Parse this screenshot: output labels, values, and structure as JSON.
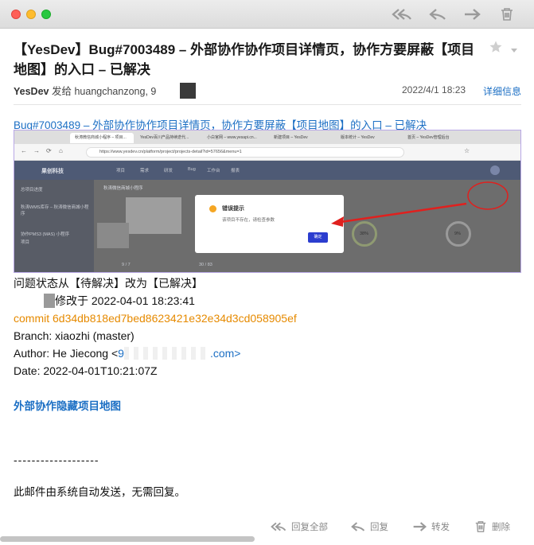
{
  "window": {
    "toolbar": [
      "reply-all-icon",
      "reply-icon",
      "forward-icon",
      "trash-icon"
    ]
  },
  "email": {
    "subject": "【YesDev】Bug#7003489 – 外部协作协作项目详情页，协作方要屏蔽【项目地图】的入口 – 已解决",
    "sender": "YesDev",
    "sent_to_label": "发给",
    "recipient": "huangchanzong, 9",
    "date": "2022/4/1  18:23",
    "details_link": "详细信息",
    "link_text": "Bug#7003489 – 外部协作协作项目详情页，协作方要屏蔽【项目地图】的入口 – 已解决",
    "status_line": "问题状态从【待解决】改为【已解决】",
    "modified_line": "修改于 2022-04-01 18:23:41",
    "commit_line": "commit 6d34db818ed7bed8623421e32e34d3cd058905ef",
    "branch_line": "Branch: xiaozhi (master)",
    "author_prefix": "Author: He Jiecong <",
    "author_email_start": "9",
    "author_email_end": ".com>",
    "date_line": "Date: 2022-04-01T10:21:07Z",
    "hidden_map_link": "外部协作隐藏项目地图",
    "dashes": "-------------------",
    "auto_notice": "此邮件由系统自动发送，无需回复。"
  },
  "screenshot": {
    "tabs": [
      "秋涛微信商城小程序 – 项目...",
      "YesDev百川产品持续迭代...",
      "小白官网 – www.yesapi.cn...",
      "新建项目 – YesDev",
      "版本统计 – YesDev",
      "首页 – YesDev管理后台"
    ],
    "url": "https://www.yesdev.cn/platform/project/projects-detail?id=57656&menu=1",
    "brand": "果创科技",
    "nav": [
      "项目",
      "需求",
      "研发",
      "Bug",
      "工作台",
      "报表"
    ],
    "sidebar": [
      "总项目进度",
      "秋涛WMS库存 – 秋涛微信商城小程序",
      "协作PMS3 (MAS) 小程序",
      "项目"
    ],
    "page_title": "秋涛微信商城小程序",
    "dialog": {
      "title": "错误提示",
      "message": "该项目不存在，请检查参数",
      "confirm": "确定"
    },
    "stats": [
      "9 / 7",
      "30 / 83",
      "38%",
      "9%"
    ],
    "colors": {
      "arrow": "#e0201e",
      "dialog_button": "#2b3dcf"
    }
  },
  "footer": {
    "reply_all": "回复全部",
    "reply": "回复",
    "forward": "转发",
    "delete": "删除"
  }
}
